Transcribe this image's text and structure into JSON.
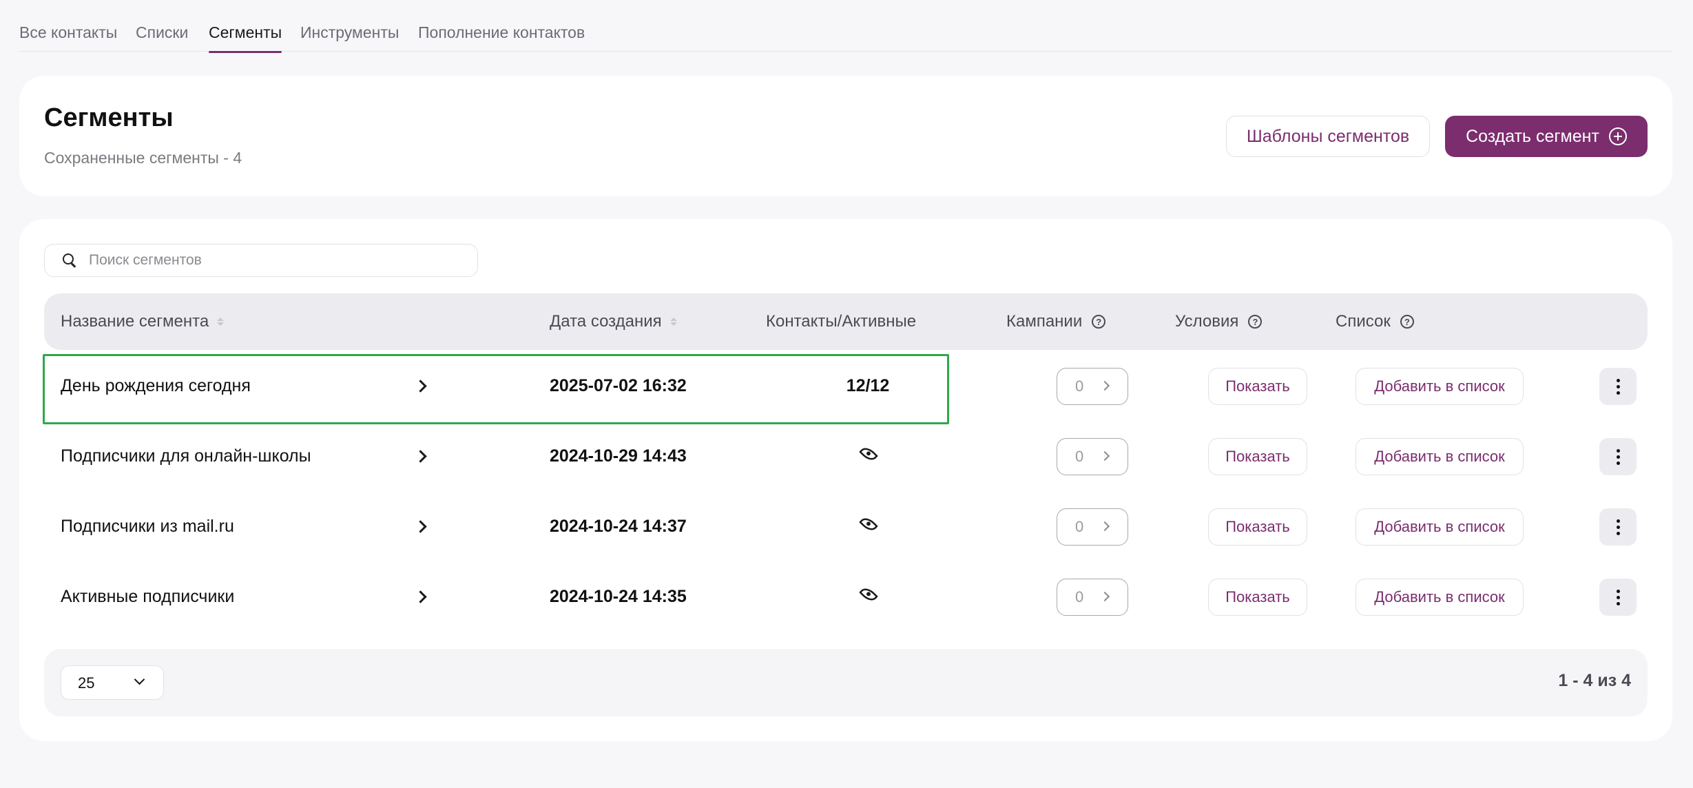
{
  "tabs": [
    {
      "label": "Все контакты"
    },
    {
      "label": "Списки"
    },
    {
      "label": "Сегменты"
    },
    {
      "label": "Инструменты"
    },
    {
      "label": "Пополнение контактов"
    }
  ],
  "active_tab": "Сегменты",
  "header": {
    "title": "Сегменты",
    "subtitle": "Сохраненные сегменты - 4",
    "templates_button": "Шаблоны сегментов",
    "create_button": "Создать сегмент"
  },
  "search": {
    "placeholder": "Поиск сегментов"
  },
  "table": {
    "columns": {
      "name": "Название сегмента",
      "date": "Дата создания",
      "contacts": "Контакты/Активные",
      "campaigns": "Кампании",
      "conditions": "Условия",
      "list": "Список"
    },
    "rows": [
      {
        "name": "День рождения сегодня",
        "date": "2025-07-02 16:32",
        "contacts": "12/12",
        "campaigns": "0",
        "show_label": "Показать",
        "add_label": "Добавить в список"
      },
      {
        "name": "Подписчики для онлайн-школы",
        "date": "2024-10-29 14:43",
        "contacts": "",
        "campaigns": "0",
        "show_label": "Показать",
        "add_label": "Добавить в список"
      },
      {
        "name": "Подписчики из mail.ru",
        "date": "2024-10-24 14:37",
        "contacts": "",
        "campaigns": "0",
        "show_label": "Показать",
        "add_label": "Добавить в список"
      },
      {
        "name": "Активные подписчики",
        "date": "2024-10-24 14:35",
        "contacts": "",
        "campaigns": "0",
        "show_label": "Показать",
        "add_label": "Добавить в список"
      }
    ]
  },
  "footer": {
    "page_size": "25",
    "pagination": "1 - 4 из 4"
  },
  "colors": {
    "accent": "#7b2d6e",
    "highlight": "#2ea84a",
    "background": "#f7f7fa"
  }
}
